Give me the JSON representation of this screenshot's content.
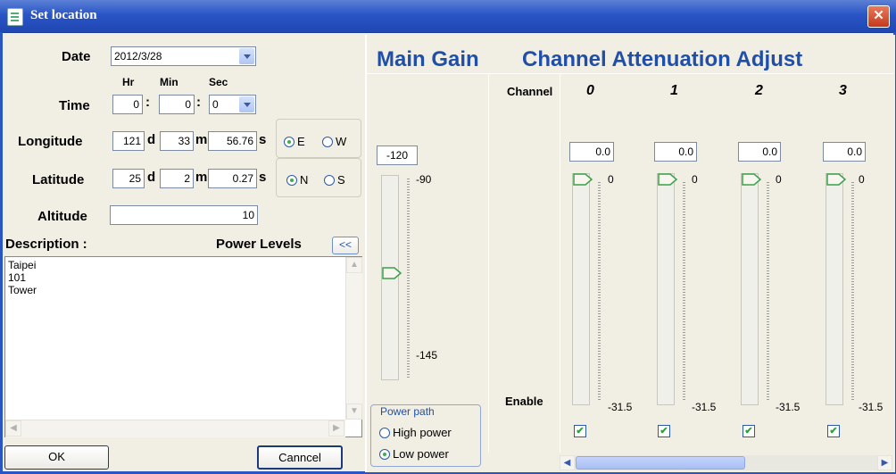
{
  "window": {
    "title": "Set location"
  },
  "form": {
    "date_label": "Date",
    "date_value": "2012/3/28",
    "time_label": "Time",
    "hr_label": "Hr",
    "min_label": "Min",
    "sec_label": "Sec",
    "hr_value": "0",
    "min_value": "0",
    "sec_value": "0",
    "longitude_label": "Longitude",
    "lon_d": "121",
    "lon_m": "33",
    "lon_s": "56.76",
    "latitude_label": "Latitude",
    "lat_d": "25",
    "lat_m": "2",
    "lat_s": "0.27",
    "unit_d": "d",
    "unit_m": "m",
    "unit_s": "s",
    "colon": ":",
    "ew_options": [
      "E",
      "W"
    ],
    "ew_selected": "E",
    "ns_options": [
      "N",
      "S"
    ],
    "ns_selected": "N",
    "altitude_label": "Altitude",
    "altitude_value": "10",
    "description_label": "Description :",
    "power_levels_label": "Power Levels",
    "power_levels_btn": "<<",
    "description_lines": [
      "Taipei",
      "101",
      "Tower"
    ]
  },
  "buttons": {
    "ok": "OK",
    "cancel": "Canncel"
  },
  "main_gain": {
    "title": "Main Gain",
    "value": "-120",
    "max_label": "-90",
    "min_label": "-145"
  },
  "power_path": {
    "title": "Power path",
    "options": [
      "High power",
      "Low power"
    ],
    "selected": "Low power"
  },
  "channels": {
    "title": "Channel Attenuation  Adjust",
    "channel_label": "Channel",
    "enable_label": "Enable",
    "items": [
      {
        "id": "0",
        "value": "0.0",
        "top_label": "0",
        "bottom_label": "-31.5",
        "enabled": true
      },
      {
        "id": "1",
        "value": "0.0",
        "top_label": "0",
        "bottom_label": "-31.5",
        "enabled": true
      },
      {
        "id": "2",
        "value": "0.0",
        "top_label": "0",
        "bottom_label": "-31.5",
        "enabled": true
      },
      {
        "id": "3",
        "value": "0.0",
        "top_label": "0",
        "bottom_label": "-31.5",
        "enabled": true
      }
    ]
  },
  "icons": {
    "close": "close-icon",
    "window": "window-icon",
    "dropdown": "chevron-down-icon"
  }
}
